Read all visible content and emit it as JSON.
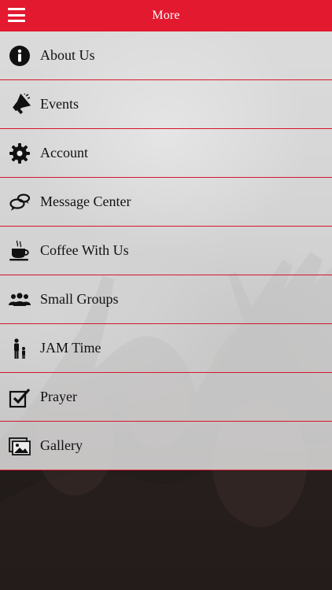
{
  "header": {
    "title": "More",
    "menu_icon": "hamburger-menu-icon",
    "background_color": "#e3192f"
  },
  "menu": {
    "items": [
      {
        "label": "About Us",
        "icon": "info-icon"
      },
      {
        "label": "Events",
        "icon": "megaphone-icon"
      },
      {
        "label": "Account",
        "icon": "gear-icon"
      },
      {
        "label": "Message Center",
        "icon": "chat-bubbles-icon"
      },
      {
        "label": "Coffee With Us",
        "icon": "coffee-cup-icon"
      },
      {
        "label": "Small Groups",
        "icon": "group-icon"
      },
      {
        "label": "JAM Time",
        "icon": "parent-child-icon"
      },
      {
        "label": "Prayer",
        "icon": "checkbox-icon"
      },
      {
        "label": "Gallery",
        "icon": "gallery-icon"
      }
    ],
    "divider_color": "#d4162c"
  }
}
